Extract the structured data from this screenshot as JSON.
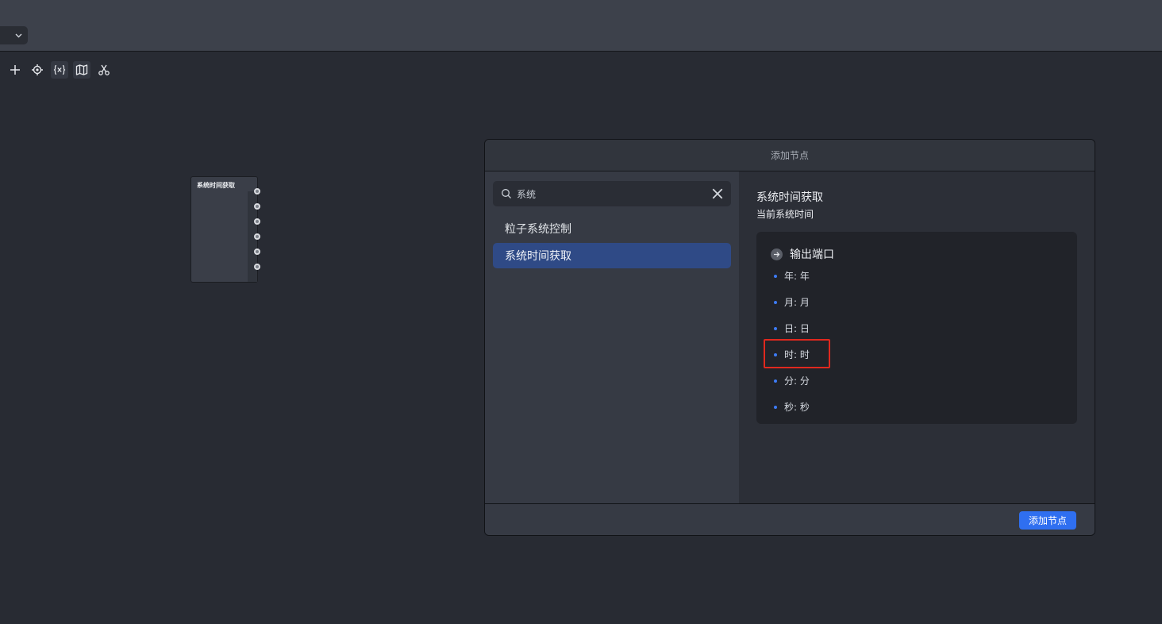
{
  "toolbar": {
    "icons": [
      "plus-icon",
      "target-icon",
      "variable-icon",
      "map-icon",
      "scissors-icon"
    ]
  },
  "canvas": {
    "node": {
      "title": "系统时间获取",
      "port_count": 6
    }
  },
  "dialog": {
    "title": "添加节点",
    "search": {
      "value": "系统",
      "placeholder": ""
    },
    "results": [
      {
        "label": "粒子系统控制",
        "selected": false
      },
      {
        "label": "系统时间获取",
        "selected": true
      }
    ],
    "detail": {
      "title": "系统时间获取",
      "description": "当前系统时间",
      "ports_heading": "输出端口",
      "ports": [
        "年: 年",
        "月: 月",
        "日: 日",
        "时: 时",
        "分: 分",
        "秒: 秒"
      ],
      "highlighted_port": "时: 时"
    },
    "add_button": "添加节点"
  },
  "colors": {
    "accent": "#2f6ff0",
    "selection": "#2f4a86",
    "highlight": "#e0281e"
  }
}
